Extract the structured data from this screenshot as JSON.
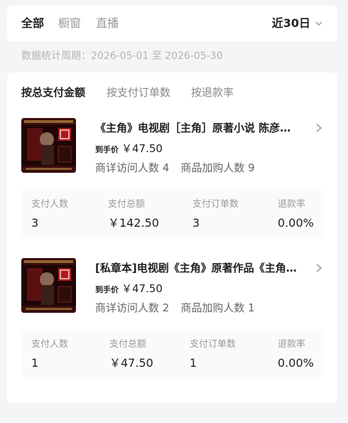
{
  "tabs": [
    {
      "label": "全部",
      "active": true
    },
    {
      "label": "橱窗",
      "active": false
    },
    {
      "label": "直播",
      "active": false
    }
  ],
  "period": {
    "label": "近30日",
    "icon": "chevron-down-icon"
  },
  "stat_range": "数据统计周期：2026-05-01 至 2026-05-30",
  "sort_tabs": [
    {
      "label": "按总支付金额",
      "active": true
    },
    {
      "label": "按支付订单数",
      "active": false
    },
    {
      "label": "按退款率",
      "active": false
    }
  ],
  "products": [
    {
      "title": "《主角》电视剧［主角］原著小说 陈彦著 茅盾文学奖",
      "price_label": "到手价",
      "price": "￥47.50",
      "detail_visits": "商详访问人数 4",
      "cart_adds": "商品加购人数 9",
      "metrics": [
        {
          "label": "支付人数",
          "value": "3"
        },
        {
          "label": "支付总额",
          "value": "￥142.50"
        },
        {
          "label": "支付订单数",
          "value": "3"
        },
        {
          "label": "退款率",
          "value": "0.00%"
        }
      ]
    },
    {
      "title": "[私章本]电视剧《主角》原著作品《主角》陈彦",
      "price_label": "到手价",
      "price": "￥47.50",
      "detail_visits": "商详访问人数 2",
      "cart_adds": "商品加购人数 1",
      "metrics": [
        {
          "label": "支付人数",
          "value": "1"
        },
        {
          "label": "支付总额",
          "value": "￥47.50"
        },
        {
          "label": "支付订单数",
          "value": "1"
        },
        {
          "label": "退款率",
          "value": "0.00%"
        }
      ]
    }
  ],
  "colors": {
    "background": "#f5f5f7",
    "card": "#ffffff",
    "metric_bg": "#fafafc",
    "muted": "#999999"
  }
}
